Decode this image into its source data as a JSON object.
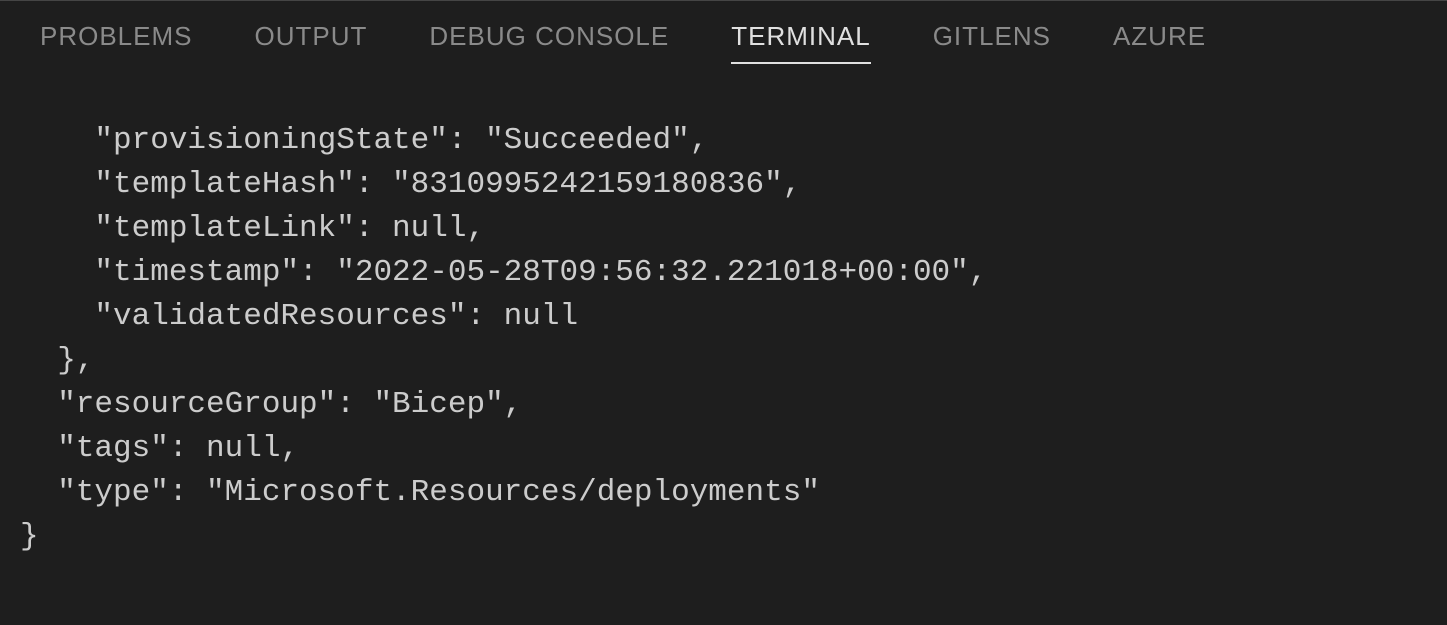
{
  "tabs": {
    "problems": "PROBLEMS",
    "output": "OUTPUT",
    "debug_console": "DEBUG CONSOLE",
    "terminal": "TERMINAL",
    "gitlens": "GITLENS",
    "azure": "AZURE"
  },
  "terminal": {
    "line1": "    \"provisioningState\": \"Succeeded\",",
    "line2": "    \"templateHash\": \"8310995242159180836\",",
    "line3": "    \"templateLink\": null,",
    "line4": "    \"timestamp\": \"2022-05-28T09:56:32.221018+00:00\",",
    "line5": "    \"validatedResources\": null",
    "line6": "  },",
    "line7": "  \"resourceGroup\": \"Bicep\",",
    "line8": "  \"tags\": null,",
    "line9": "  \"type\": \"Microsoft.Resources/deployments\"",
    "line10": "}"
  }
}
